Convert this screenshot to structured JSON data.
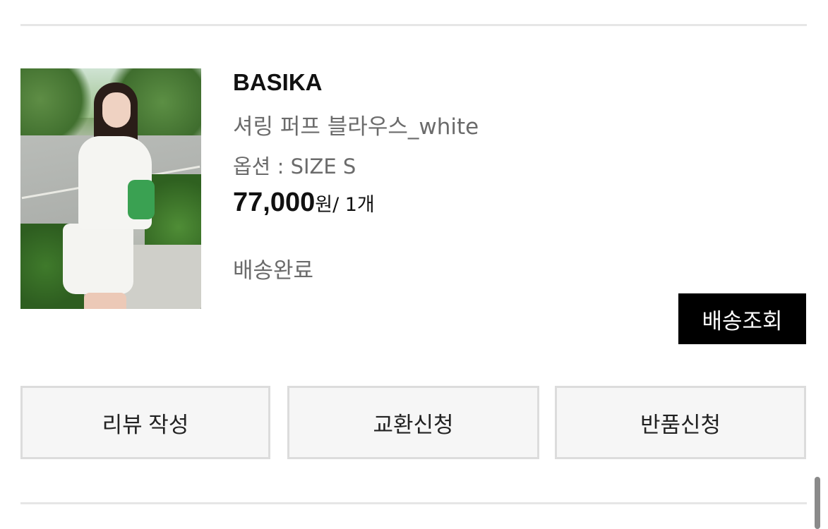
{
  "order_item": {
    "brand": "BASIKA",
    "product_name": "셔링 퍼프 블라우스_white",
    "option": "옵션 : SIZE S",
    "price_amount": "77,000",
    "price_unit": "원",
    "quantity": "/ 1개",
    "status": "배송완료",
    "thumbnail_alt": "BASIKA 셔링 퍼프 블라우스 상품 이미지"
  },
  "buttons": {
    "track_delivery": "배송조회",
    "write_review": "리뷰 작성",
    "request_exchange": "교환신청",
    "request_return": "반품신청"
  },
  "colors": {
    "primary_button": "#000000",
    "secondary_text": "#6b6b6b",
    "divider": "#e6e6e6"
  }
}
